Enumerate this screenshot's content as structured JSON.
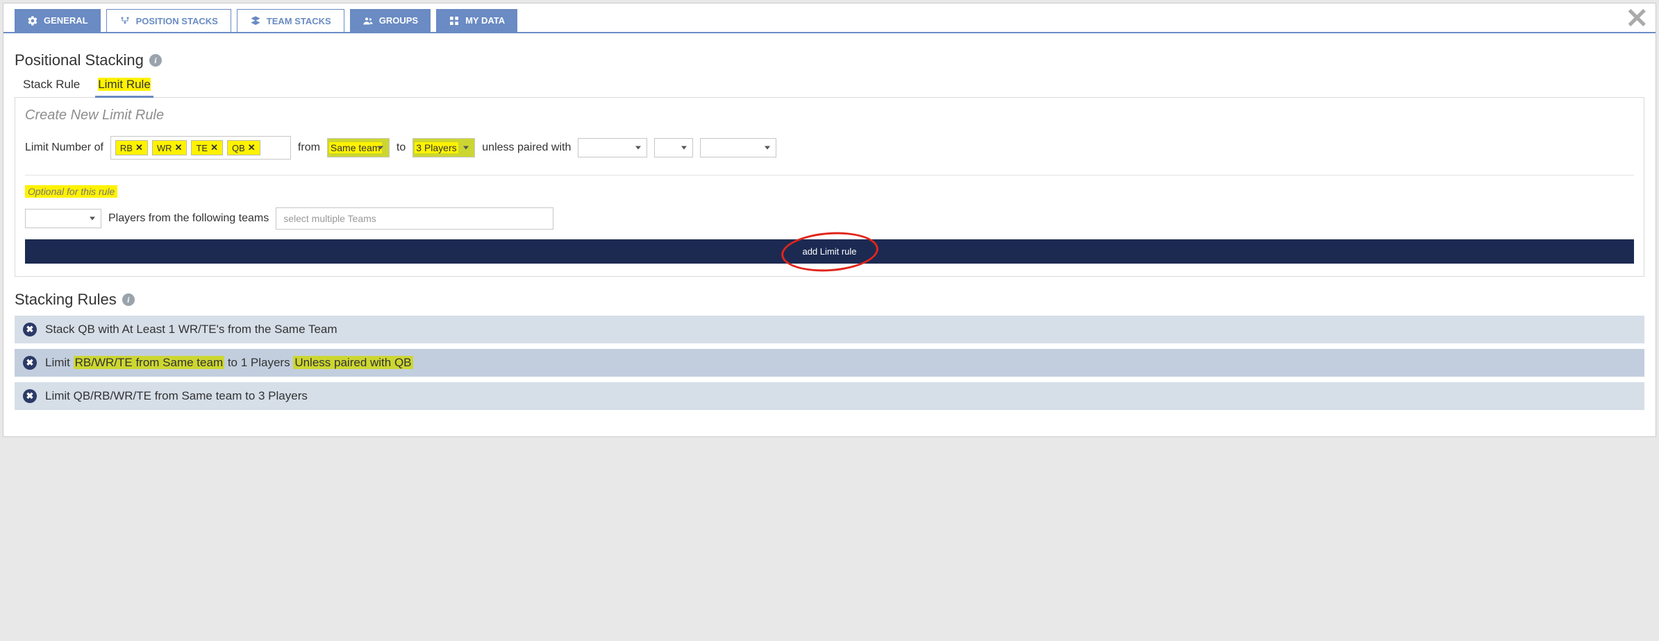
{
  "tabs": {
    "general": "GENERAL",
    "position_stacks": "POSITION STACKS",
    "team_stacks": "TEAM STACKS",
    "groups": "GROUPS",
    "my_data": "MY DATA"
  },
  "positional_heading": "Positional Stacking",
  "subtabs": {
    "stack_rule": "Stack Rule",
    "limit_rule": "Limit Rule"
  },
  "panel": {
    "heading": "Create New Limit Rule",
    "limit_label": "Limit Number of",
    "tags": [
      "RB",
      "WR",
      "TE",
      "QB"
    ],
    "from_label": "from",
    "from_value": "Same team",
    "to_label": "to",
    "to_value": "3 Players",
    "unless_label": "unless paired with",
    "optional_label": "Optional for this rule",
    "teams_label": "Players from the following teams",
    "teams_placeholder": "select multiple Teams",
    "add_rule_button": "add Limit rule"
  },
  "rules_heading": "Stacking Rules",
  "rules": [
    {
      "pre": "",
      "text": "Stack QB with At Least 1 WR/TE's from the Same Team",
      "segments": [
        {
          "t": "Stack QB with At Least 1 WR/TE's from the Same Team"
        }
      ]
    },
    {
      "pre": "",
      "segments": [
        {
          "t": "Limit "
        },
        {
          "t": "RB/WR/TE from Same team",
          "hl": true
        },
        {
          "t": " to 1 Players "
        },
        {
          "t": "Unless paired with QB",
          "hl": true
        }
      ],
      "selected": true
    },
    {
      "segments": [
        {
          "t": "Limit QB/RB/WR/TE from Same team to 3 Players"
        }
      ]
    }
  ]
}
